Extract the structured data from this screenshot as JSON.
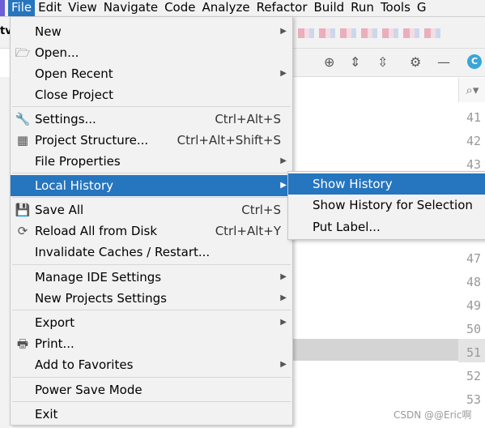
{
  "menubar": {
    "items": [
      "File",
      "Edit",
      "View",
      "Navigate",
      "Code",
      "Analyze",
      "Refactor",
      "Build",
      "Run",
      "Tools",
      "G"
    ]
  },
  "project_tab": "tv",
  "gutter": {
    "line_numbers": [
      "41",
      "42",
      "43",
      "",
      "",
      "",
      "47",
      "48",
      "49",
      "50",
      "51",
      "52",
      "53"
    ]
  },
  "file_menu": {
    "items": [
      {
        "label": "New",
        "shortcut": "",
        "submenu": true,
        "icon": ""
      },
      {
        "label": "Open...",
        "shortcut": "",
        "submenu": false,
        "icon": "folder-icon"
      },
      {
        "label": "Open Recent",
        "shortcut": "",
        "submenu": true,
        "icon": ""
      },
      {
        "label": "Close Project",
        "shortcut": "",
        "submenu": false,
        "icon": ""
      },
      {
        "label": "Settings...",
        "shortcut": "Ctrl+Alt+S",
        "submenu": false,
        "icon": "wrench-icon"
      },
      {
        "label": "Project Structure...",
        "shortcut": "Ctrl+Alt+Shift+S",
        "submenu": false,
        "icon": "project-structure-icon"
      },
      {
        "label": "File Properties",
        "shortcut": "",
        "submenu": true,
        "icon": ""
      },
      {
        "label": "Local History",
        "shortcut": "",
        "submenu": true,
        "icon": "",
        "selected": true
      },
      {
        "label": "Save All",
        "shortcut": "Ctrl+S",
        "submenu": false,
        "icon": "save-icon"
      },
      {
        "label": "Reload All from Disk",
        "shortcut": "Ctrl+Alt+Y",
        "submenu": false,
        "icon": "reload-icon"
      },
      {
        "label": "Invalidate Caches / Restart...",
        "shortcut": "",
        "submenu": false,
        "icon": ""
      },
      {
        "label": "Manage IDE Settings",
        "shortcut": "",
        "submenu": true,
        "icon": ""
      },
      {
        "label": "New Projects Settings",
        "shortcut": "",
        "submenu": true,
        "icon": ""
      },
      {
        "label": "Export",
        "shortcut": "",
        "submenu": true,
        "icon": ""
      },
      {
        "label": "Print...",
        "shortcut": "",
        "submenu": false,
        "icon": "print-icon"
      },
      {
        "label": "Add to Favorites",
        "shortcut": "",
        "submenu": true,
        "icon": ""
      },
      {
        "label": "Power Save Mode",
        "shortcut": "",
        "submenu": false,
        "icon": ""
      },
      {
        "label": "Exit",
        "shortcut": "",
        "submenu": false,
        "icon": ""
      }
    ]
  },
  "local_history_submenu": {
    "items": [
      {
        "label": "Show History",
        "selected": true
      },
      {
        "label": "Show History for Selection"
      },
      {
        "label": "Put Label..."
      }
    ]
  },
  "watermark": "CSDN @@Eric啊",
  "colors": {
    "selection": "#2675bf",
    "menu_bg": "#f2f2f2"
  }
}
